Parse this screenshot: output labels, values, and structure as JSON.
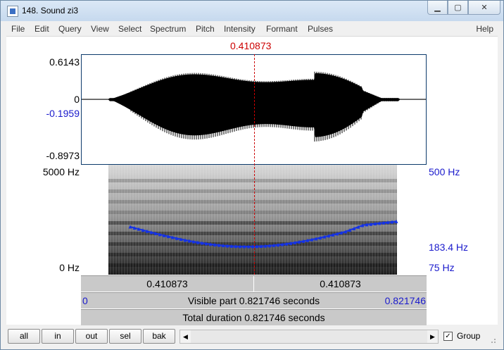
{
  "window": {
    "title": "148. Sound zi3",
    "controls": [
      "minimize",
      "maximize",
      "close"
    ]
  },
  "menu": [
    "File",
    "Edit",
    "Query",
    "View",
    "Select",
    "Spectrum",
    "Pitch",
    "Intensity",
    "Formant",
    "Pulses"
  ],
  "help_label": "Help",
  "cursor": {
    "time_label": "0.410873",
    "position_fraction": 0.5
  },
  "waveform": {
    "y_max": "0.6143",
    "zero": "0",
    "cursor_value": "-0.1959",
    "y_min": "-0.8973"
  },
  "spectrogram": {
    "freq_max": "5000 Hz",
    "freq_min": "0 Hz",
    "pitch_max": "500 Hz",
    "pitch_cursor": "183.4 Hz",
    "pitch_min": "75 Hz"
  },
  "bars": {
    "left_part": "0.410873",
    "right_part": "0.410873",
    "visible_start": "0",
    "visible_label": "Visible part 0.821746 seconds",
    "visible_end": "0.821746",
    "total_label": "Total duration 0.821746 seconds"
  },
  "buttons": {
    "all": "all",
    "in": "in",
    "out": "out",
    "sel": "sel",
    "bak": "bak"
  },
  "group": {
    "label": "Group",
    "checked": true
  },
  "colors": {
    "cursor": "#cc0000",
    "pitch_track": "#1432e6",
    "axis_blue": "#1a1acc",
    "wave": "#000000"
  }
}
